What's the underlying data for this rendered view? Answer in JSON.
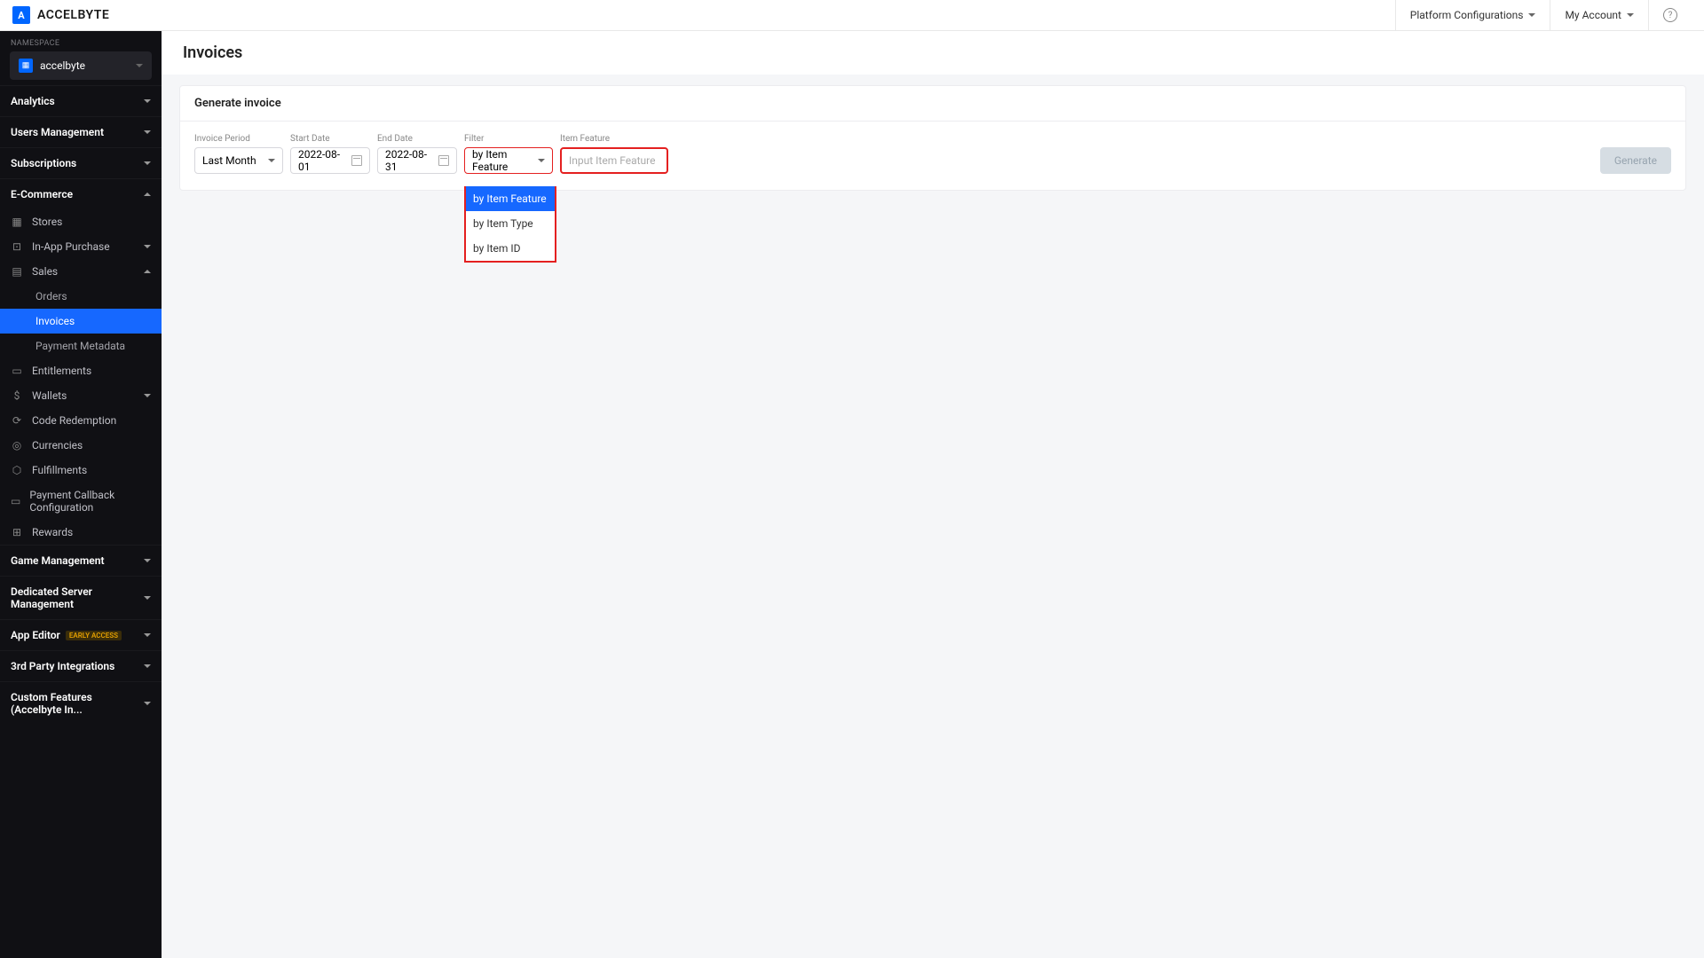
{
  "header": {
    "logo_text": "ACCELBYTE",
    "platform_config": "Platform Configurations",
    "my_account": "My Account"
  },
  "sidebar": {
    "namespace_label": "NAMESPACE",
    "namespace_selected": "accelbyte",
    "groups": {
      "analytics": "Analytics",
      "users_mgmt": "Users Management",
      "subscriptions": "Subscriptions",
      "ecommerce": "E-Commerce",
      "game_mgmt": "Game Management",
      "dedicated_server": "Dedicated Server Management",
      "app_editor": "App Editor",
      "app_editor_badge": "EARLY ACCESS",
      "third_party": "3rd Party Integrations",
      "custom_features": "Custom Features (Accelbyte In..."
    },
    "ecommerce_items": {
      "stores": "Stores",
      "iap": "In-App Purchase",
      "sales": "Sales",
      "orders": "Orders",
      "invoices": "Invoices",
      "payment_meta": "Payment Metadata",
      "entitlements": "Entitlements",
      "wallets": "Wallets",
      "code_redemption": "Code Redemption",
      "currencies": "Currencies",
      "fulfillments": "Fulfillments",
      "payment_cb": "Payment Callback Configuration",
      "rewards": "Rewards"
    }
  },
  "page": {
    "title": "Invoices",
    "panel_title": "Generate invoice",
    "fields": {
      "period_label": "Invoice Period",
      "period_value": "Last Month",
      "start_label": "Start Date",
      "start_value": "2022-08-01",
      "end_label": "End Date",
      "end_value": "2022-08-31",
      "filter_label": "Filter",
      "filter_value": "by Item Feature",
      "feature_label": "Item Feature",
      "feature_placeholder": "Input Item Feature",
      "generate_btn": "Generate"
    },
    "filter_options": {
      "opt1": "by Item Feature",
      "opt2": "by Item Type",
      "opt3": "by Item ID"
    }
  }
}
